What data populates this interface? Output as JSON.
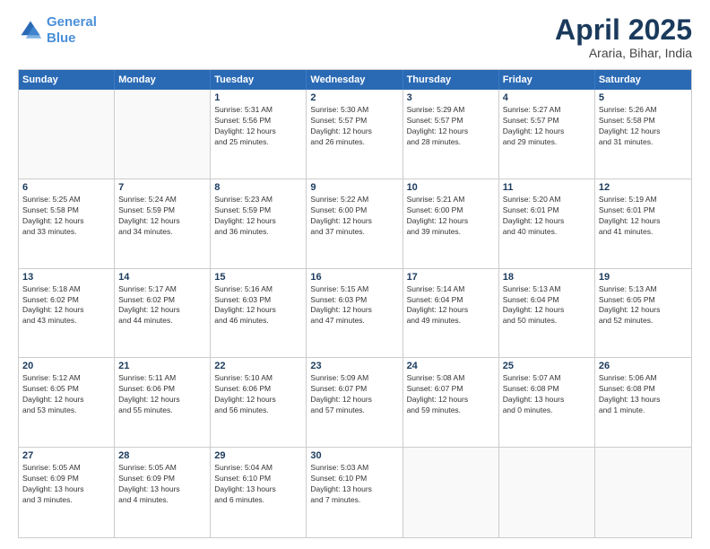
{
  "header": {
    "logo_line1": "General",
    "logo_line2": "Blue",
    "title": "April 2025",
    "subtitle": "Araria, Bihar, India"
  },
  "days_of_week": [
    "Sunday",
    "Monday",
    "Tuesday",
    "Wednesday",
    "Thursday",
    "Friday",
    "Saturday"
  ],
  "weeks": [
    [
      {
        "day": "",
        "lines": []
      },
      {
        "day": "",
        "lines": []
      },
      {
        "day": "1",
        "lines": [
          "Sunrise: 5:31 AM",
          "Sunset: 5:56 PM",
          "Daylight: 12 hours",
          "and 25 minutes."
        ]
      },
      {
        "day": "2",
        "lines": [
          "Sunrise: 5:30 AM",
          "Sunset: 5:57 PM",
          "Daylight: 12 hours",
          "and 26 minutes."
        ]
      },
      {
        "day": "3",
        "lines": [
          "Sunrise: 5:29 AM",
          "Sunset: 5:57 PM",
          "Daylight: 12 hours",
          "and 28 minutes."
        ]
      },
      {
        "day": "4",
        "lines": [
          "Sunrise: 5:27 AM",
          "Sunset: 5:57 PM",
          "Daylight: 12 hours",
          "and 29 minutes."
        ]
      },
      {
        "day": "5",
        "lines": [
          "Sunrise: 5:26 AM",
          "Sunset: 5:58 PM",
          "Daylight: 12 hours",
          "and 31 minutes."
        ]
      }
    ],
    [
      {
        "day": "6",
        "lines": [
          "Sunrise: 5:25 AM",
          "Sunset: 5:58 PM",
          "Daylight: 12 hours",
          "and 33 minutes."
        ]
      },
      {
        "day": "7",
        "lines": [
          "Sunrise: 5:24 AM",
          "Sunset: 5:59 PM",
          "Daylight: 12 hours",
          "and 34 minutes."
        ]
      },
      {
        "day": "8",
        "lines": [
          "Sunrise: 5:23 AM",
          "Sunset: 5:59 PM",
          "Daylight: 12 hours",
          "and 36 minutes."
        ]
      },
      {
        "day": "9",
        "lines": [
          "Sunrise: 5:22 AM",
          "Sunset: 6:00 PM",
          "Daylight: 12 hours",
          "and 37 minutes."
        ]
      },
      {
        "day": "10",
        "lines": [
          "Sunrise: 5:21 AM",
          "Sunset: 6:00 PM",
          "Daylight: 12 hours",
          "and 39 minutes."
        ]
      },
      {
        "day": "11",
        "lines": [
          "Sunrise: 5:20 AM",
          "Sunset: 6:01 PM",
          "Daylight: 12 hours",
          "and 40 minutes."
        ]
      },
      {
        "day": "12",
        "lines": [
          "Sunrise: 5:19 AM",
          "Sunset: 6:01 PM",
          "Daylight: 12 hours",
          "and 41 minutes."
        ]
      }
    ],
    [
      {
        "day": "13",
        "lines": [
          "Sunrise: 5:18 AM",
          "Sunset: 6:02 PM",
          "Daylight: 12 hours",
          "and 43 minutes."
        ]
      },
      {
        "day": "14",
        "lines": [
          "Sunrise: 5:17 AM",
          "Sunset: 6:02 PM",
          "Daylight: 12 hours",
          "and 44 minutes."
        ]
      },
      {
        "day": "15",
        "lines": [
          "Sunrise: 5:16 AM",
          "Sunset: 6:03 PM",
          "Daylight: 12 hours",
          "and 46 minutes."
        ]
      },
      {
        "day": "16",
        "lines": [
          "Sunrise: 5:15 AM",
          "Sunset: 6:03 PM",
          "Daylight: 12 hours",
          "and 47 minutes."
        ]
      },
      {
        "day": "17",
        "lines": [
          "Sunrise: 5:14 AM",
          "Sunset: 6:04 PM",
          "Daylight: 12 hours",
          "and 49 minutes."
        ]
      },
      {
        "day": "18",
        "lines": [
          "Sunrise: 5:13 AM",
          "Sunset: 6:04 PM",
          "Daylight: 12 hours",
          "and 50 minutes."
        ]
      },
      {
        "day": "19",
        "lines": [
          "Sunrise: 5:13 AM",
          "Sunset: 6:05 PM",
          "Daylight: 12 hours",
          "and 52 minutes."
        ]
      }
    ],
    [
      {
        "day": "20",
        "lines": [
          "Sunrise: 5:12 AM",
          "Sunset: 6:05 PM",
          "Daylight: 12 hours",
          "and 53 minutes."
        ]
      },
      {
        "day": "21",
        "lines": [
          "Sunrise: 5:11 AM",
          "Sunset: 6:06 PM",
          "Daylight: 12 hours",
          "and 55 minutes."
        ]
      },
      {
        "day": "22",
        "lines": [
          "Sunrise: 5:10 AM",
          "Sunset: 6:06 PM",
          "Daylight: 12 hours",
          "and 56 minutes."
        ]
      },
      {
        "day": "23",
        "lines": [
          "Sunrise: 5:09 AM",
          "Sunset: 6:07 PM",
          "Daylight: 12 hours",
          "and 57 minutes."
        ]
      },
      {
        "day": "24",
        "lines": [
          "Sunrise: 5:08 AM",
          "Sunset: 6:07 PM",
          "Daylight: 12 hours",
          "and 59 minutes."
        ]
      },
      {
        "day": "25",
        "lines": [
          "Sunrise: 5:07 AM",
          "Sunset: 6:08 PM",
          "Daylight: 13 hours",
          "and 0 minutes."
        ]
      },
      {
        "day": "26",
        "lines": [
          "Sunrise: 5:06 AM",
          "Sunset: 6:08 PM",
          "Daylight: 13 hours",
          "and 1 minute."
        ]
      }
    ],
    [
      {
        "day": "27",
        "lines": [
          "Sunrise: 5:05 AM",
          "Sunset: 6:09 PM",
          "Daylight: 13 hours",
          "and 3 minutes."
        ]
      },
      {
        "day": "28",
        "lines": [
          "Sunrise: 5:05 AM",
          "Sunset: 6:09 PM",
          "Daylight: 13 hours",
          "and 4 minutes."
        ]
      },
      {
        "day": "29",
        "lines": [
          "Sunrise: 5:04 AM",
          "Sunset: 6:10 PM",
          "Daylight: 13 hours",
          "and 6 minutes."
        ]
      },
      {
        "day": "30",
        "lines": [
          "Sunrise: 5:03 AM",
          "Sunset: 6:10 PM",
          "Daylight: 13 hours",
          "and 7 minutes."
        ]
      },
      {
        "day": "",
        "lines": []
      },
      {
        "day": "",
        "lines": []
      },
      {
        "day": "",
        "lines": []
      }
    ]
  ]
}
